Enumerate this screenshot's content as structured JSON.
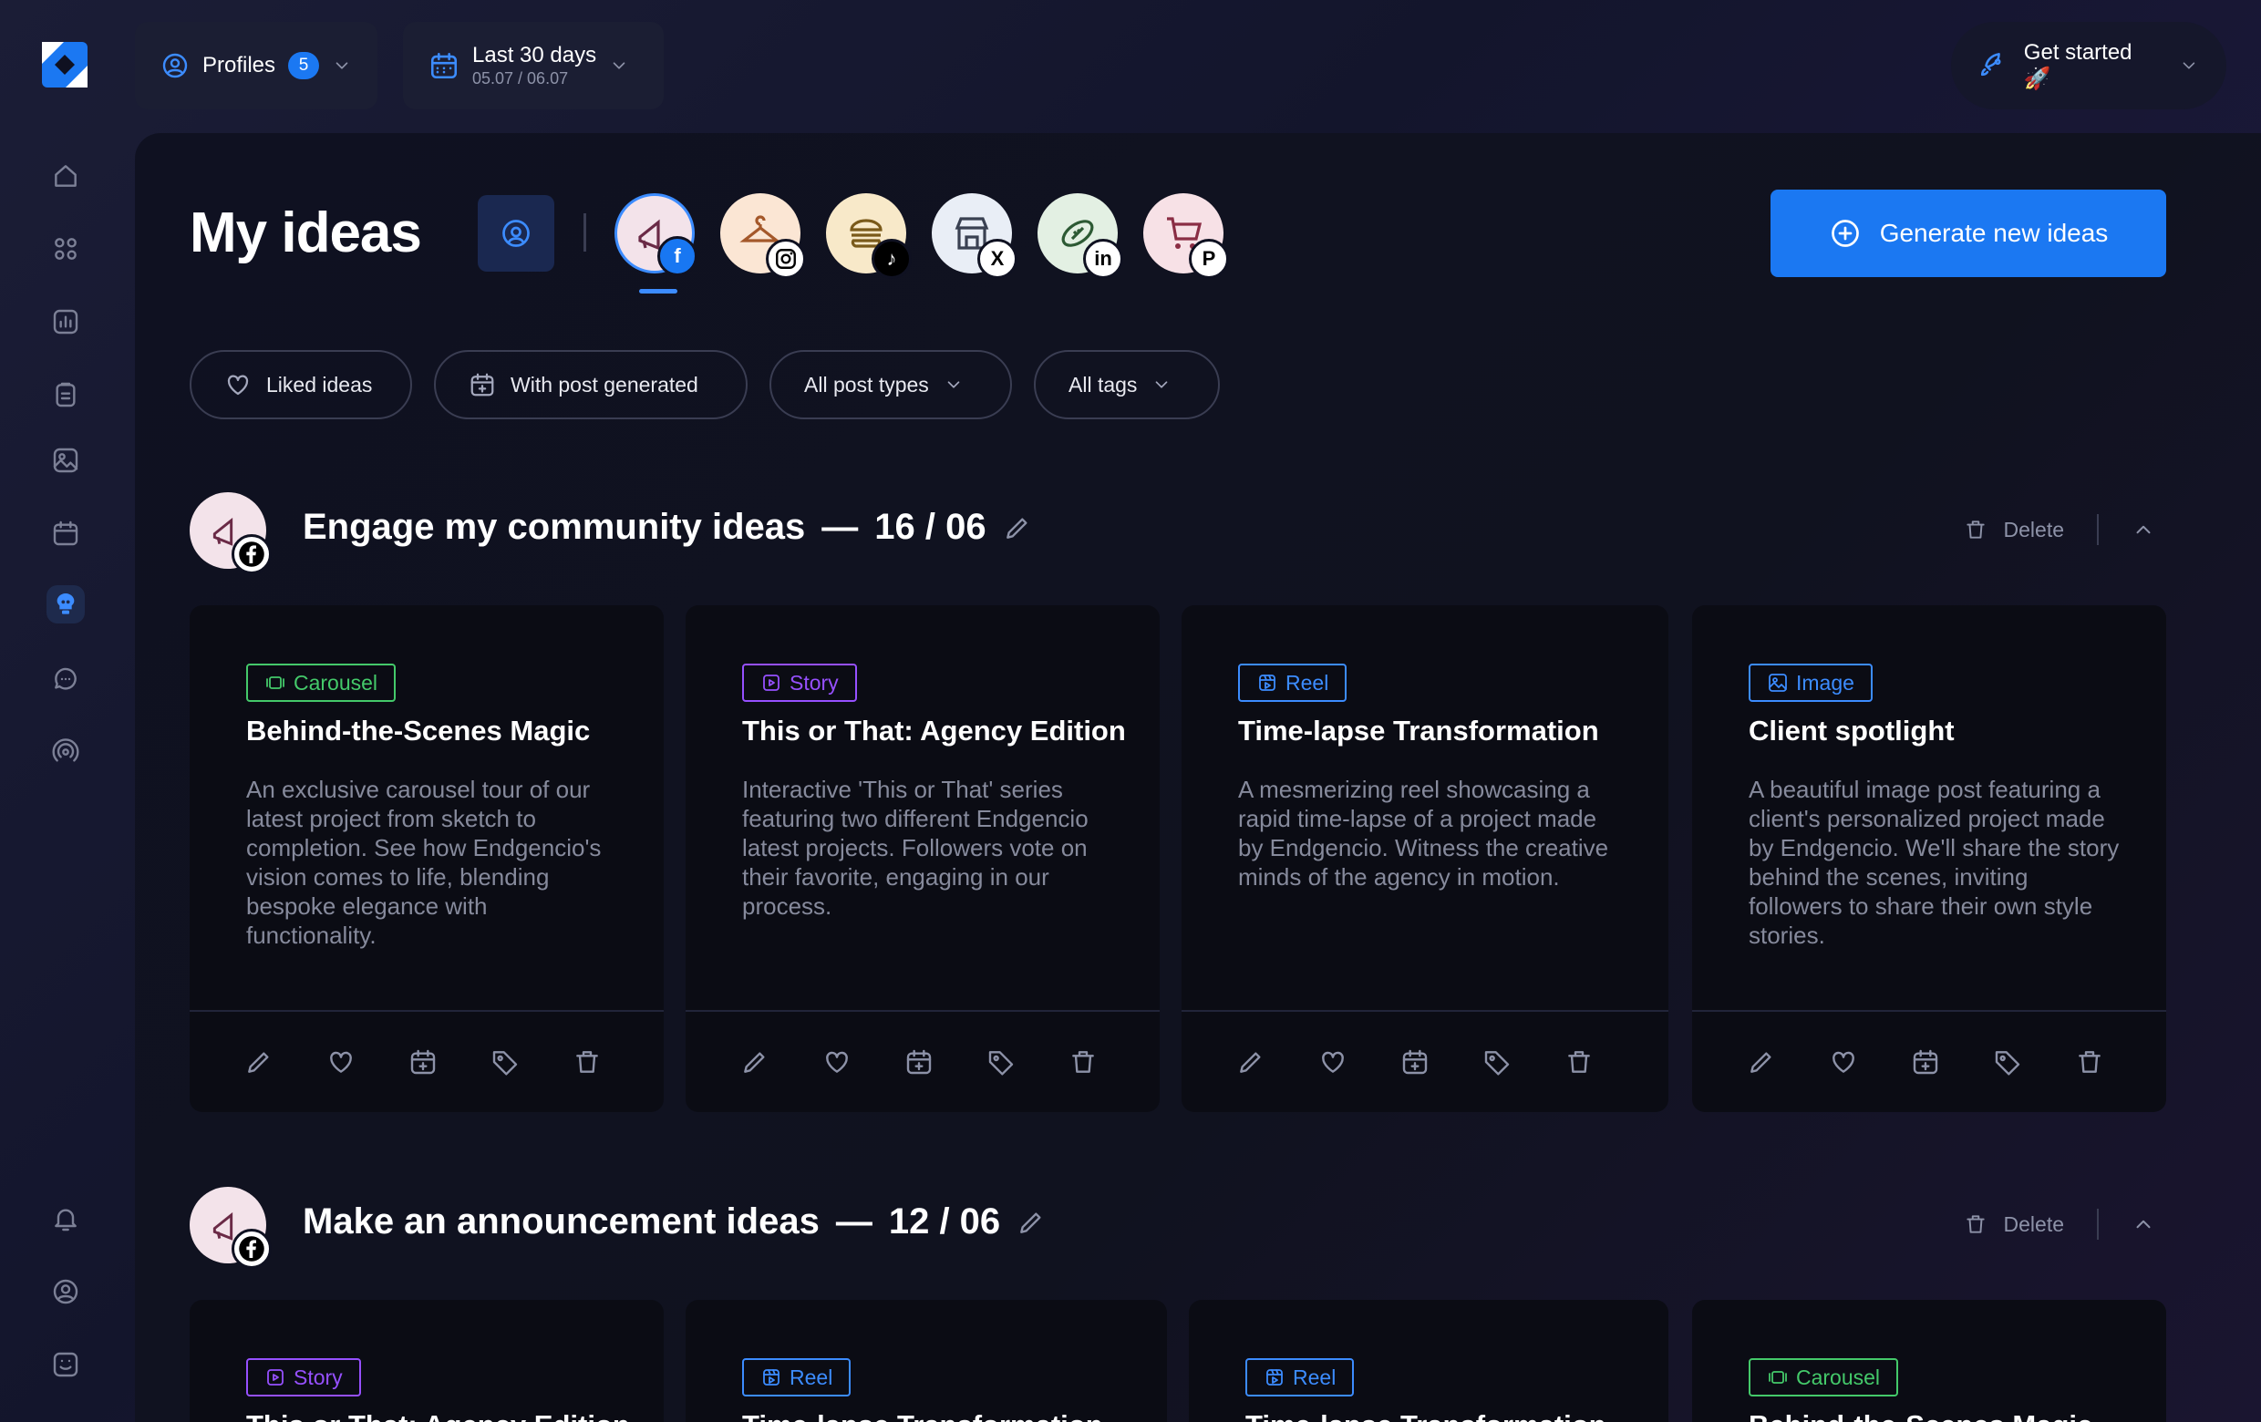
{
  "colors": {
    "accent": "#1b78f2",
    "carousel": "#44c96a",
    "story": "#9650ff",
    "reel": "#3c8cff",
    "image": "#3c8cff"
  },
  "topbar": {
    "profiles_label": "Profiles",
    "profiles_count": "5",
    "date_range": "Last 30 days",
    "date_sub": "05.07 / 06.07",
    "get_started": "Get started 🚀"
  },
  "sidebar": {
    "items": [
      "home-icon",
      "dashboard-icon",
      "analytics-icon",
      "clipboard-icon",
      "media-icon",
      "calendar-icon",
      "ideas-icon",
      "chat-icon",
      "broadcast-icon",
      "bell-icon",
      "account-icon",
      "support-icon"
    ],
    "active": "ideas-icon"
  },
  "page": {
    "title": "My ideas",
    "generate_label": "Generate new ideas"
  },
  "profiles": [
    {
      "network": "facebook",
      "icon": "megaphone-icon",
      "active": true
    },
    {
      "network": "instagram",
      "icon": "hanger-icon"
    },
    {
      "network": "tiktok",
      "icon": "burger-icon"
    },
    {
      "network": "x",
      "icon": "store-icon"
    },
    {
      "network": "linkedin",
      "icon": "football-icon"
    },
    {
      "network": "pinterest",
      "icon": "cart-icon"
    }
  ],
  "filters": {
    "liked": "Liked ideas",
    "with_post": "With post generated",
    "post_types": "All post types",
    "tags": "All tags"
  },
  "sections": [
    {
      "title": "Engage my community ideas",
      "date": "16 / 06",
      "delete_label": "Delete",
      "cards": [
        {
          "type": "Carousel",
          "title": "Behind-the-Scenes Magic",
          "desc": "An exclusive carousel tour of our latest project from sketch to completion. See how Endgencio's vision comes to life, blending bespoke elegance with functionality."
        },
        {
          "type": "Story",
          "title": "This or That: Agency Edition",
          "desc": "Interactive 'This or That' series featuring two different Endgencio latest projects. Followers vote on their favorite, engaging in our process."
        },
        {
          "type": "Reel",
          "title": "Time-lapse Transformation",
          "desc": "A mesmerizing reel showcasing a rapid time-lapse of a project made by Endgencio. Witness the creative minds of the agency in motion."
        },
        {
          "type": "Image",
          "title": "Client spotlight",
          "desc": "A beautiful image post featuring a client's personalized project made by Endgencio. We'll share the story behind the scenes, inviting followers to share their own style stories."
        }
      ]
    },
    {
      "title": "Make an announcement ideas",
      "date": "12 / 06",
      "delete_label": "Delete",
      "cards": [
        {
          "type": "Story",
          "title": "This or That: Agency Edition"
        },
        {
          "type": "Reel",
          "title": "Time-lapse Transformation"
        },
        {
          "type": "Reel",
          "title": "Time-lapse Transformation"
        },
        {
          "type": "Carousel",
          "title": "Behind-the-Scenes Magic"
        }
      ]
    }
  ]
}
